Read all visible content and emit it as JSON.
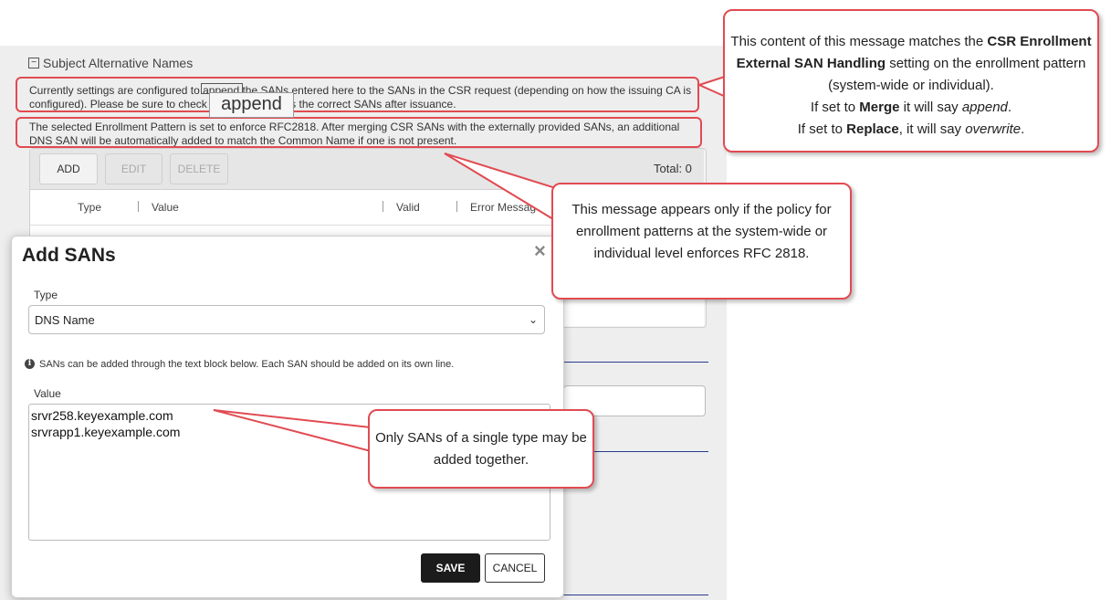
{
  "section": {
    "title": "Subject Alternative Names"
  },
  "messages": {
    "append_settings": "Currently settings are configured to append the SANs entered here to the SANs in the CSR request (depending on how the issuing CA is configured). Please be sure to check the certificate has the correct SANs after issuance.",
    "rfc2818": "The selected Enrollment Pattern is set to enforce RFC2818. After merging CSR SANs with the externally provided SANs, an additional DNS SAN will be automatically added to match the Common Name if one is not present.",
    "append_zoom": "append"
  },
  "grid": {
    "add": "ADD",
    "edit": "EDIT",
    "delete": "DELETE",
    "total": "Total: 0",
    "columns": [
      "Type",
      "Value",
      "Valid",
      "Error Message"
    ]
  },
  "modal": {
    "title": "Add SANs",
    "close_glyph": "×",
    "type_label": "Type",
    "type_value": "DNS Name",
    "info": "SANs can be added through the text block below. Each SAN should be added on its own line.",
    "value_label": "Value",
    "values": [
      "srvr258.keyexample.com",
      "srvrapp1.keyexample.com"
    ],
    "save": "SAVE",
    "cancel": "CANCEL"
  },
  "callouts": {
    "csr": {
      "line1": "This content of this message matches the",
      "bold1": "CSR Enrollment External SAN Handling",
      "line2": "setting on the enrollment pattern (system-wide or individual).",
      "merge_prefix": "If set to",
      "merge_bold": "Merge",
      "merge_mid": "it will say",
      "merge_word": "append",
      "replace_prefix": "If set to",
      "replace_bold": "Replace",
      "replace_mid": ", it will say",
      "replace_word": "overwrite"
    },
    "rfc": "This message appears only if the policy for enrollment patterns at the system-wide or individual level enforces RFC 2818.",
    "single_type": "Only SANs of a single type may be added together."
  },
  "colors": {
    "callout_border": "#e14b52",
    "save_bg": "#1b1b1b",
    "link_line": "#2a3b8f"
  },
  "icons": [
    "collapse-icon",
    "close-icon",
    "chevron-down-icon",
    "info-icon"
  ]
}
